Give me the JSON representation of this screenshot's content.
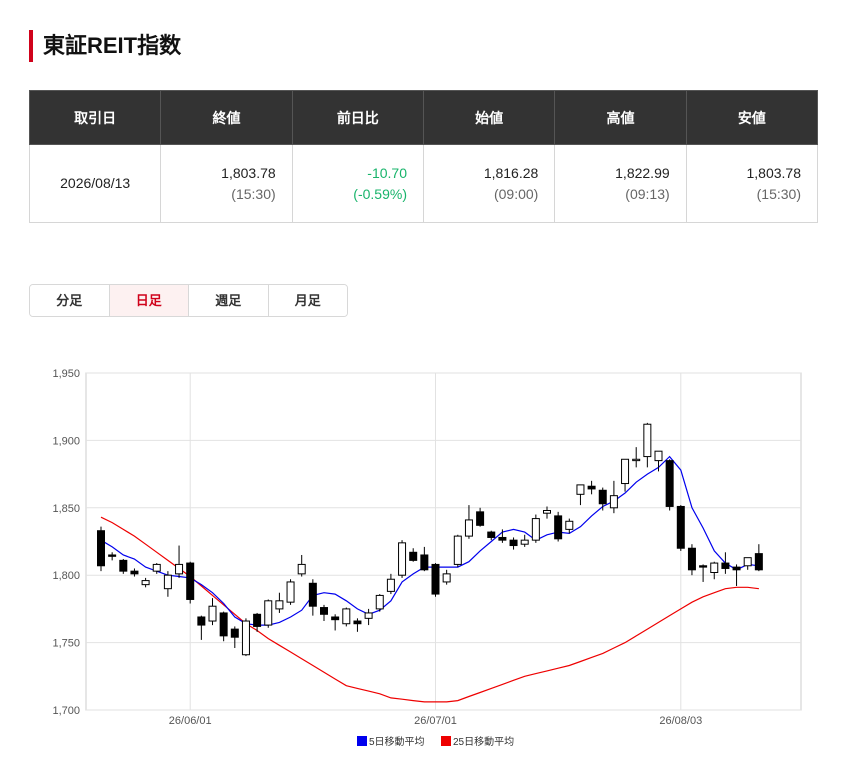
{
  "page": {
    "title": "東証REIT指数"
  },
  "quote": {
    "headers": [
      "取引日",
      "終値",
      "前日比",
      "始値",
      "高値",
      "安値"
    ],
    "date": "2026/08/13",
    "close": "1,803.78",
    "close_time": "(15:30)",
    "change": "-10.70",
    "change_pct": "(-0.59%)",
    "open": "1,816.28",
    "open_time": "(09:00)",
    "high": "1,822.99",
    "high_time": "(09:13)",
    "low": "1,803.78",
    "low_time": "(15:30)"
  },
  "tabs": [
    {
      "label": "分足",
      "active": false
    },
    {
      "label": "日足",
      "active": true
    },
    {
      "label": "週足",
      "active": false
    },
    {
      "label": "月足",
      "active": false
    }
  ],
  "colors": {
    "accent": "#d0021b",
    "change": "#18b46b",
    "ma5": "#0000ee",
    "ma25": "#ee0000"
  },
  "chart_data": {
    "type": "candlestick",
    "yticks": [
      1700,
      1750,
      1800,
      1850,
      1900,
      1950
    ],
    "ytick_labels": [
      "1,700",
      "1,750",
      "1,800",
      "1,850",
      "1,900",
      "1,950"
    ],
    "ylim": [
      1700,
      1950
    ],
    "grid": true,
    "xtick_labels": [
      {
        "index": 8,
        "label": "26/06/01"
      },
      {
        "index": 30,
        "label": "26/07/01"
      },
      {
        "index": 52,
        "label": "26/08/03"
      }
    ],
    "legend": [
      {
        "name": "5日移動平均",
        "color": "#0000ee"
      },
      {
        "name": "25日移動平均",
        "color": "#ee0000"
      }
    ],
    "legend_placement": "bottom-center",
    "candles": [
      [
        1833,
        1836,
        1803,
        1807
      ],
      [
        1815,
        1817,
        1811,
        1814
      ],
      [
        1811,
        1812,
        1801,
        1803
      ],
      [
        1803,
        1805,
        1799,
        1801
      ],
      [
        1793,
        1798,
        1791,
        1796
      ],
      [
        1803,
        1809,
        1801,
        1808
      ],
      [
        1790,
        1803,
        1784,
        1800
      ],
      [
        1801,
        1822,
        1798,
        1808
      ],
      [
        1809,
        1810,
        1779,
        1782
      ],
      [
        1769,
        1770,
        1752,
        1763
      ],
      [
        1766,
        1783,
        1763,
        1777
      ],
      [
        1772,
        1773,
        1751,
        1755
      ],
      [
        1760,
        1762,
        1746,
        1754
      ],
      [
        1741,
        1768,
        1740,
        1766
      ],
      [
        1771,
        1772,
        1758,
        1762
      ],
      [
        1763,
        1782,
        1761,
        1781
      ],
      [
        1775,
        1787,
        1772,
        1781
      ],
      [
        1780,
        1797,
        1778,
        1795
      ],
      [
        1801,
        1815,
        1799,
        1808
      ],
      [
        1794,
        1797,
        1770,
        1777
      ],
      [
        1776,
        1778,
        1766,
        1771
      ],
      [
        1769,
        1771,
        1759,
        1767
      ],
      [
        1764,
        1776,
        1762,
        1775
      ],
      [
        1766,
        1768,
        1758,
        1764
      ],
      [
        1768,
        1775,
        1763,
        1772
      ],
      [
        1775,
        1786,
        1773,
        1785
      ],
      [
        1788,
        1801,
        1786,
        1797
      ],
      [
        1800,
        1826,
        1798,
        1824
      ],
      [
        1817,
        1820,
        1810,
        1811
      ],
      [
        1815,
        1821,
        1803,
        1804
      ],
      [
        1808,
        1809,
        1784,
        1786
      ],
      [
        1795,
        1804,
        1793,
        1801
      ],
      [
        1808,
        1830,
        1806,
        1829
      ],
      [
        1829,
        1852,
        1827,
        1841
      ],
      [
        1847,
        1850,
        1836,
        1837
      ],
      [
        1832,
        1833,
        1826,
        1828
      ],
      [
        1828,
        1834,
        1824,
        1826
      ],
      [
        1826,
        1828,
        1819,
        1822
      ],
      [
        1823,
        1830,
        1821,
        1826
      ],
      [
        1826,
        1845,
        1824,
        1842
      ],
      [
        1846,
        1851,
        1842,
        1848
      ],
      [
        1844,
        1847,
        1825,
        1827
      ],
      [
        1834,
        1842,
        1831,
        1840
      ],
      [
        1860,
        1867,
        1852,
        1867
      ],
      [
        1866,
        1870,
        1860,
        1864
      ],
      [
        1863,
        1865,
        1848,
        1853
      ],
      [
        1850,
        1870,
        1846,
        1859
      ],
      [
        1868,
        1886,
        1862,
        1886
      ],
      [
        1885,
        1895,
        1880,
        1886
      ],
      [
        1888,
        1913,
        1880,
        1912
      ],
      [
        1885,
        1891,
        1877,
        1892
      ],
      [
        1885,
        1886,
        1848,
        1851
      ],
      [
        1851,
        1852,
        1818,
        1820
      ],
      [
        1820,
        1823,
        1800,
        1804
      ],
      [
        1807,
        1808,
        1795,
        1806
      ],
      [
        1802,
        1810,
        1797,
        1809
      ],
      [
        1809,
        1817,
        1801,
        1805
      ],
      [
        1806,
        1808,
        1792,
        1804
      ],
      [
        1807,
        1813,
        1804,
        1813
      ],
      [
        1816,
        1823,
        1803,
        1804
      ]
    ],
    "ma5": [
      1826,
      1821,
      1815,
      1812,
      1806,
      1803,
      1800,
      1799,
      1798,
      1793,
      1787,
      1779,
      1769,
      1764,
      1763,
      1763,
      1765,
      1769,
      1774,
      1785,
      1787,
      1786,
      1781,
      1775,
      1771,
      1774,
      1781,
      1795,
      1801,
      1806,
      1806,
      1806,
      1806,
      1810,
      1818,
      1825,
      1832,
      1834,
      1832,
      1826,
      1830,
      1832,
      1831,
      1836,
      1844,
      1851,
      1855,
      1861,
      1869,
      1875,
      1880,
      1888,
      1878,
      1850,
      1835,
      1818,
      1809,
      1804,
      1808,
      1807
    ],
    "ma25": [
      1843,
      1839,
      1834,
      1829,
      1823,
      1817,
      1811,
      1805,
      1799,
      1792,
      1785,
      1778,
      1771,
      1764,
      1759,
      1753,
      1748,
      1743,
      1738,
      1733,
      1728,
      1723,
      1718,
      1716,
      1714,
      1712,
      1709,
      1708,
      1707,
      1706,
      1706,
      1706,
      1707,
      1710,
      1713,
      1716,
      1719,
      1722,
      1725,
      1727,
      1729,
      1731,
      1733,
      1736,
      1739,
      1742,
      1746,
      1750,
      1755,
      1760,
      1765,
      1770,
      1775,
      1780,
      1784,
      1787,
      1790,
      1791,
      1791,
      1790
    ]
  }
}
